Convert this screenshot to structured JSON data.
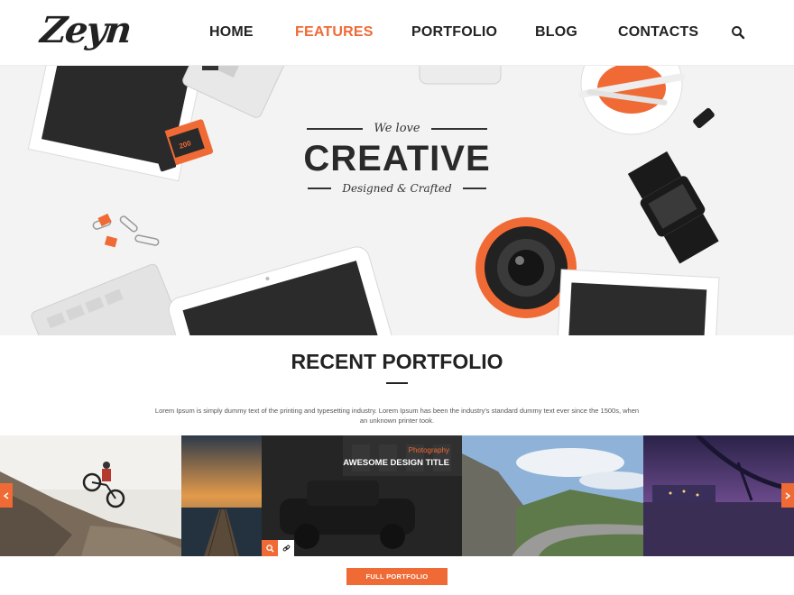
{
  "brand": {
    "logo_text": "Zeyn"
  },
  "nav": {
    "items": [
      {
        "label": "HOME",
        "active": false
      },
      {
        "label": "FEATURES",
        "active": true
      },
      {
        "label": "PORTFOLIO",
        "active": false
      },
      {
        "label": "BLOG",
        "active": false
      },
      {
        "label": "CONTACTS",
        "active": false
      }
    ],
    "search_icon": "search-icon"
  },
  "hero": {
    "top_line": "We love",
    "headline": "CREATIVE",
    "bottom_line": "Designed & Crafted",
    "film_label": "200"
  },
  "portfolio": {
    "title": "RECENT PORTFOLIO",
    "description": "Lorem Ipsum is simply dummy text of the printing and typesetting industry. Lorem Ipsum has been the industry's standard dummy text ever since the 1500s, when an unknown printer took.",
    "featured_item": {
      "category": "Photography",
      "title": "AWESOME DESIGN TITLE"
    },
    "button_label": "FULL PORTFOLIO"
  },
  "colors": {
    "accent": "#f06a35",
    "text": "#222222",
    "hero_bg": "#f3f3f3"
  }
}
